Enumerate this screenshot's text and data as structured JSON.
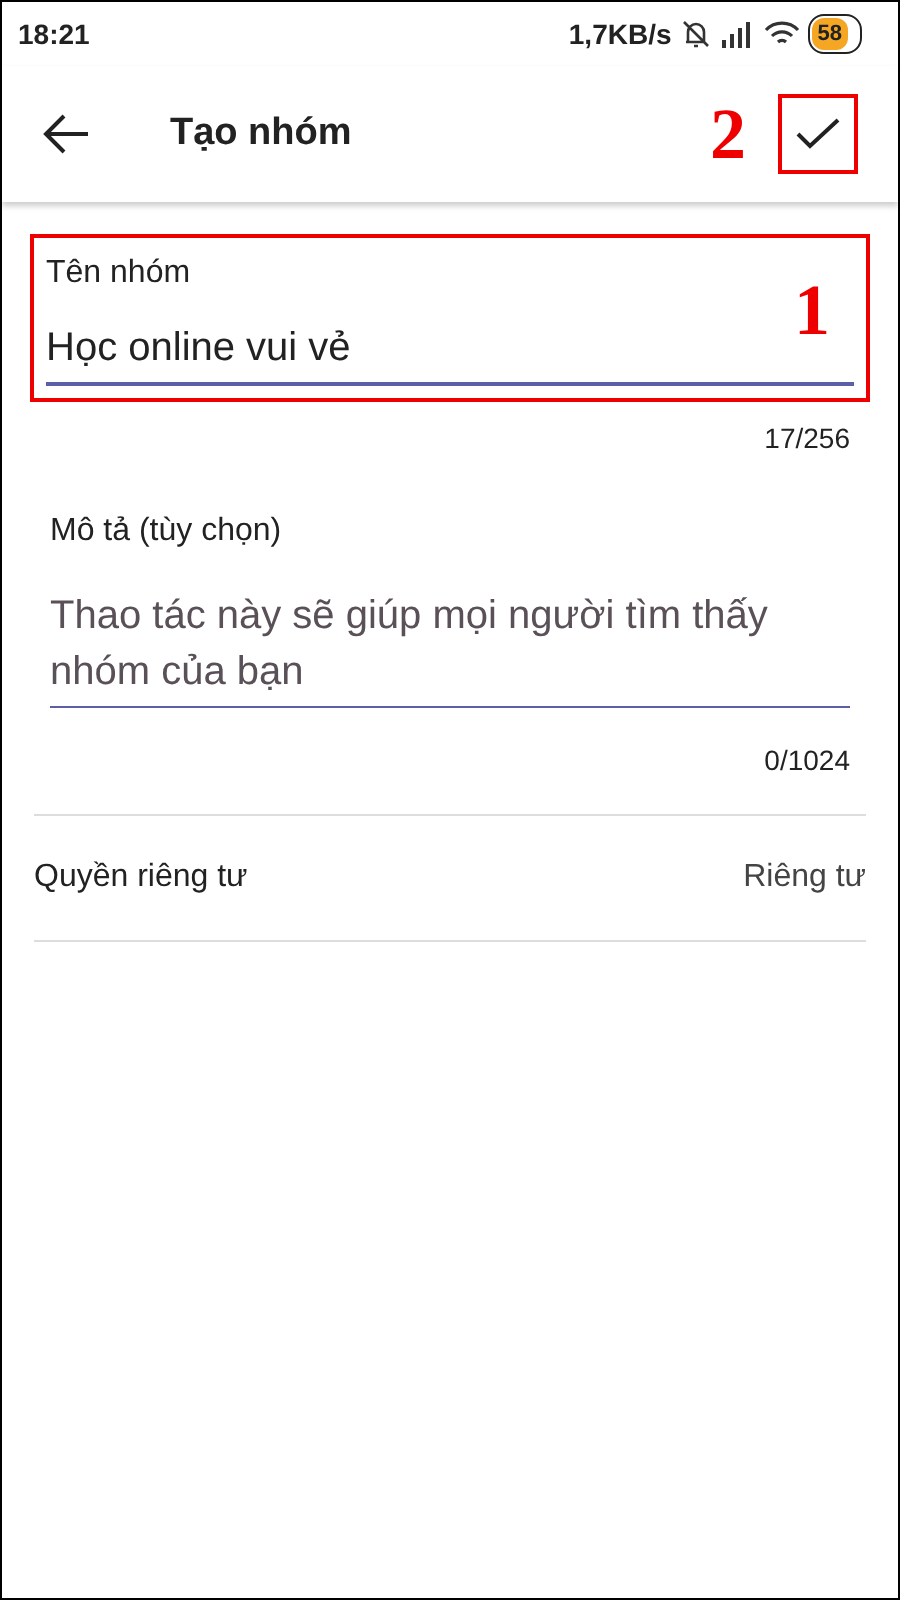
{
  "status_bar": {
    "time": "18:21",
    "speed": "1,7KB/s",
    "battery": "58"
  },
  "app_bar": {
    "title": "Tạo nhóm",
    "annotation": "2"
  },
  "name_field": {
    "label": "Tên nhóm",
    "value": "Học online vui vẻ",
    "counter": "17/256",
    "annotation": "1"
  },
  "description_field": {
    "label": "Mô tả (tùy chọn)",
    "placeholder": "Thao tác này sẽ giúp mọi người tìm thấy nhóm của bạn",
    "counter": "0/1024"
  },
  "privacy": {
    "label": "Quyền riêng tư",
    "value": "Riêng tư"
  }
}
